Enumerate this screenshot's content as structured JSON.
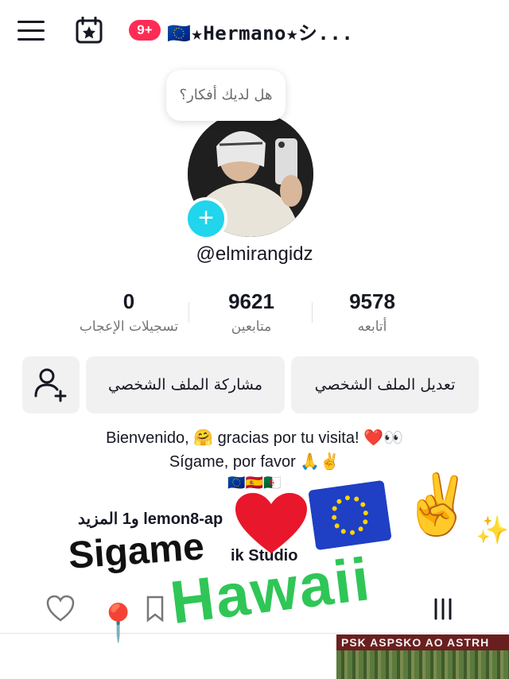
{
  "header": {
    "notification_count": "9+",
    "profile_name": "🇪🇺★Hermano★シ...",
    "icons": [
      "menu-icon",
      "calendar-star-icon"
    ]
  },
  "profile": {
    "thought_bubble": "هل لديك أفكار؟",
    "handle": "@elmirangidz",
    "avatar_add": "+"
  },
  "stats": [
    {
      "value": "0",
      "label": "تسجيلات الإعجاب"
    },
    {
      "value": "9621",
      "label": "متابعين"
    },
    {
      "value": "9578",
      "label": "أتابعه"
    }
  ],
  "buttons": {
    "edit_profile": "تعديل الملف الشخصي",
    "share_profile": "مشاركة الملف الشخصي",
    "add_friend_icon": "person-add-icon"
  },
  "bio": {
    "line1": "Bienvenido, 🤗 gracias por tu visita! ❤️👀",
    "line2": "Sígame, por favor 🙏✌️",
    "line3": "🇪🇺🇪🇸🇩🇿"
  },
  "links": {
    "row1_prefix": "lemon8-ap",
    "row1_suffix": "و1 المزيد",
    "row2": "ik Studio"
  },
  "stickers": {
    "sigame": "Sigame",
    "hawaii": "Hawaii",
    "sparkles": "✨",
    "victory": "✌️",
    "pin": "📍"
  },
  "corner_image": {
    "banner_text": "PSK ASPSKO AO ASTRH"
  },
  "colors": {
    "accent_red": "#fe2c55",
    "accent_cyan": "#20d5ec",
    "hawaii_green": "#2fc657"
  }
}
